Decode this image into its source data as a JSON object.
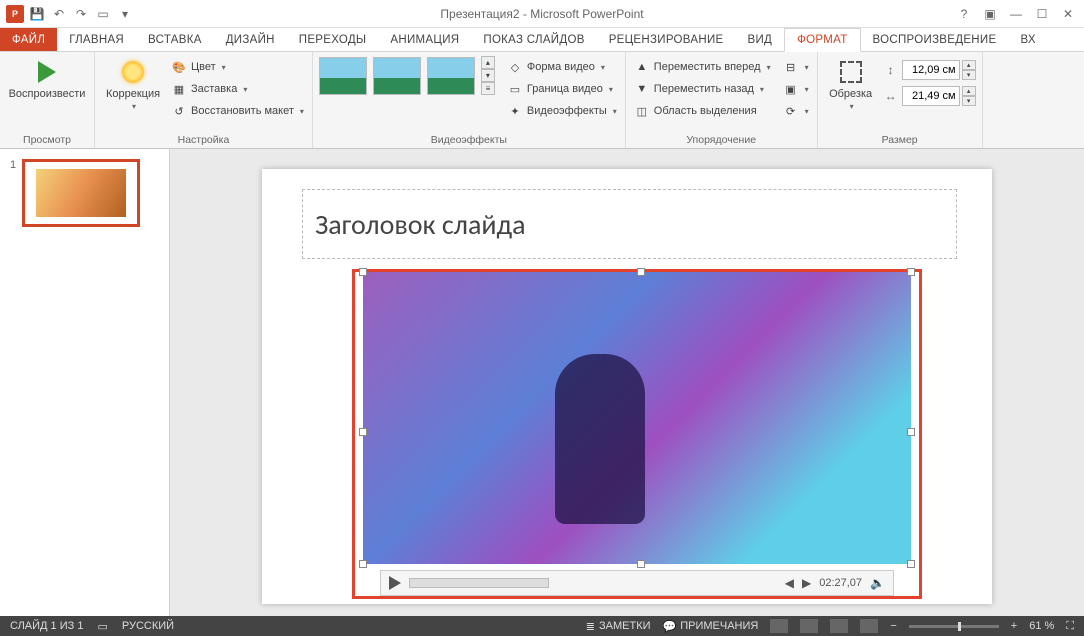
{
  "title": "Презентация2 - Microsoft PowerPoint",
  "tabs": {
    "file": "ФАЙЛ",
    "home": "ГЛАВНАЯ",
    "insert": "ВСТАВКА",
    "design": "ДИЗАЙН",
    "transitions": "ПЕРЕХОДЫ",
    "animations": "АНИМАЦИЯ",
    "slideshow": "ПОКАЗ СЛАЙДОВ",
    "review": "РЕЦЕНЗИРОВАНИЕ",
    "view": "ВИД",
    "format": "ФОРМАТ",
    "playback": "ВОСПРОИЗВЕДЕНИЕ",
    "overflow": "Вх"
  },
  "ribbon": {
    "preview": {
      "label": "Просмотр",
      "play": "Воспроизвести"
    },
    "adjust": {
      "label": "Настройка",
      "corrections": "Коррекция",
      "color": "Цвет",
      "poster": "Заставка",
      "reset": "Восстановить макет"
    },
    "effects": {
      "label": "Видеоэффекты",
      "shape": "Форма видео",
      "border": "Граница видео",
      "fx": "Видеоэффекты"
    },
    "arrange": {
      "label": "Упорядочение",
      "forward": "Переместить вперед",
      "backward": "Переместить назад",
      "selection": "Область выделения"
    },
    "size": {
      "label": "Размер",
      "crop": "Обрезка",
      "height": "12,09 см",
      "width": "21,49 см"
    }
  },
  "thumbnail": {
    "num": "1"
  },
  "slide": {
    "title": "Заголовок слайда",
    "media_time": "02:27,07"
  },
  "statusbar": {
    "slide_info": "СЛАЙД 1 ИЗ 1",
    "language": "РУССКИЙ",
    "notes": "ЗАМЕТКИ",
    "comments": "ПРИМЕЧАНИЯ",
    "zoom": "61 %"
  }
}
